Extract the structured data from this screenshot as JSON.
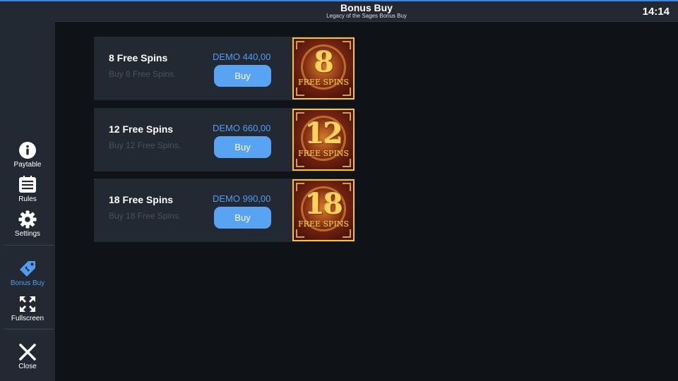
{
  "header": {
    "title": "Bonus Buy",
    "subtitle": "Legacy of the Sages Bonus Buy",
    "clock": "14:14"
  },
  "sidebar": {
    "items": [
      {
        "label": "Paytable",
        "icon": "info-icon"
      },
      {
        "label": "Rules",
        "icon": "list-icon"
      },
      {
        "label": "Settings",
        "icon": "gear-icon"
      },
      {
        "label": "Bonus Buy",
        "icon": "tag-icon",
        "active": true
      },
      {
        "label": "Fullscreen",
        "icon": "expand-icon"
      },
      {
        "label": "Close",
        "icon": "close-icon"
      }
    ]
  },
  "offers": [
    {
      "title": "8 Free Spins",
      "desc": "Buy 8 Free Spins.",
      "price": "DEMO 440,00",
      "button": "Buy",
      "badge_number": "8",
      "badge_text": "FREE SPINS"
    },
    {
      "title": "12 Free Spins",
      "desc": "Buy 12 Free Spins.",
      "price": "DEMO 660,00",
      "button": "Buy",
      "badge_number": "12",
      "badge_text": "FREE SPINS"
    },
    {
      "title": "18 Free Spins",
      "desc": "Buy 18 Free Spins.",
      "price": "DEMO 990,00",
      "button": "Buy",
      "badge_number": "18",
      "badge_text": "FREE SPINS"
    }
  ],
  "colors": {
    "accent": "#4f9cf0",
    "button": "#58a3f2",
    "panel": "#232932",
    "background": "#0f1217",
    "badge_border": "#f2c53c"
  }
}
